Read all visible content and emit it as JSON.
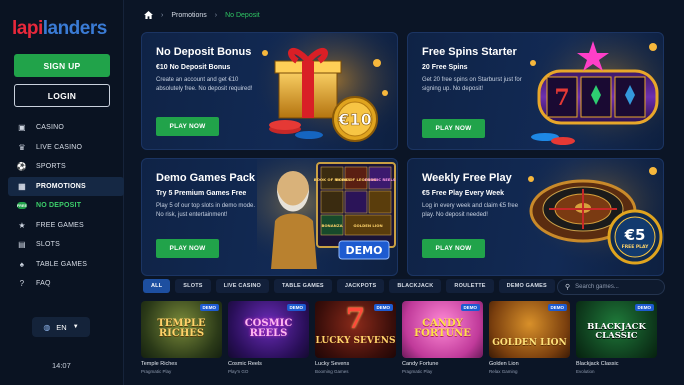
{
  "brand": {
    "part1": "lapi",
    "part2": "landers"
  },
  "auth": {
    "signup": "SIGN UP",
    "login": "LOGIN"
  },
  "nav": [
    {
      "label": "CASINO",
      "icon": "slot-machine-icon"
    },
    {
      "label": "LIVE CASINO",
      "icon": "dealer-icon"
    },
    {
      "label": "SPORTS",
      "icon": "soccer-ball-icon"
    },
    {
      "label": "PROMOTIONS",
      "icon": "gift-icon"
    },
    {
      "label": "NO DEPOSIT",
      "icon": "free-badge-icon",
      "badge": "FREE"
    },
    {
      "label": "FREE GAMES",
      "icon": "star-icon"
    },
    {
      "label": "SLOTS",
      "icon": "slots-icon"
    },
    {
      "label": "TABLE GAMES",
      "icon": "spade-icon"
    },
    {
      "label": "FAQ",
      "icon": "question-icon"
    }
  ],
  "language": "EN",
  "clock": "14:07",
  "breadcrumb": {
    "home_icon": "home-icon",
    "promotions": "Promotions",
    "current": "No Deposit"
  },
  "promos": [
    {
      "title": "No Deposit Bonus",
      "subtitle": "€10 No Deposit Bonus",
      "desc": "Create an account and get €10 absolutely free. No deposit required!",
      "cta": "PLAY NOW",
      "art_text": "€10"
    },
    {
      "title": "Free Spins Starter",
      "subtitle": "20 Free Spins",
      "desc": "Get 20 free spins on Starburst just for signing up. No deposit!",
      "cta": "PLAY NOW",
      "art_text": "7"
    },
    {
      "title": "Demo Games Pack",
      "subtitle": "Try 5 Premium Games Free",
      "desc": "Play 5 of our top slots in demo mode. No risk, just entertainment!",
      "cta": "PLAY NOW",
      "art_text": "DEMO",
      "art_tiles": [
        "BOOK OF RICHES",
        "BOOK OF LEGENDS",
        "COSMIC REELS",
        "BONANZA",
        "GOLDEN LION"
      ]
    },
    {
      "title": "Weekly Free Play",
      "subtitle": "€5 Free Play Every Week",
      "desc": "Log in every week and claim €5 free play. No deposit needed!",
      "cta": "PLAY NOW",
      "art_text": "€5",
      "art_sub": "FREE PLAY"
    }
  ],
  "filters": [
    "ALL",
    "SLOTS",
    "LIVE CASINO",
    "TABLE GAMES",
    "JACKPOTS",
    "BLACKJACK",
    "ROULETTE",
    "DEMO GAMES"
  ],
  "search": {
    "placeholder": "Search games..."
  },
  "games": [
    {
      "title_art": "TEMPLE RICHES",
      "name": "Temple Riches",
      "provider": "Pragmatic Play",
      "badge": "DEMO"
    },
    {
      "title_art": "COSMIC REELS",
      "name": "Cosmic Reels",
      "provider": "Play'n GO",
      "badge": "DEMO"
    },
    {
      "title_art": "LUCKY SEVENS",
      "name": "Lucky Sevens",
      "provider": "Booming Games",
      "badge": "DEMO",
      "art_big": "7"
    },
    {
      "title_art": "CANDY FORTUNE",
      "name": "Candy Fortune",
      "provider": "Pragmatic Play",
      "badge": "DEMO"
    },
    {
      "title_art": "GOLDEN LION",
      "name": "Golden Lion",
      "provider": "Relax Gaming",
      "badge": "DEMO"
    },
    {
      "title_art": "BLACKJACK CLASSIC",
      "name": "Blackjack Classic",
      "provider": "Evolution",
      "badge": "DEMO"
    }
  ],
  "colors": {
    "accent_green": "#21a34a",
    "accent_blue": "#1d4fa0",
    "brand_red": "#e8283b",
    "brand_blue": "#3a7bd5"
  }
}
